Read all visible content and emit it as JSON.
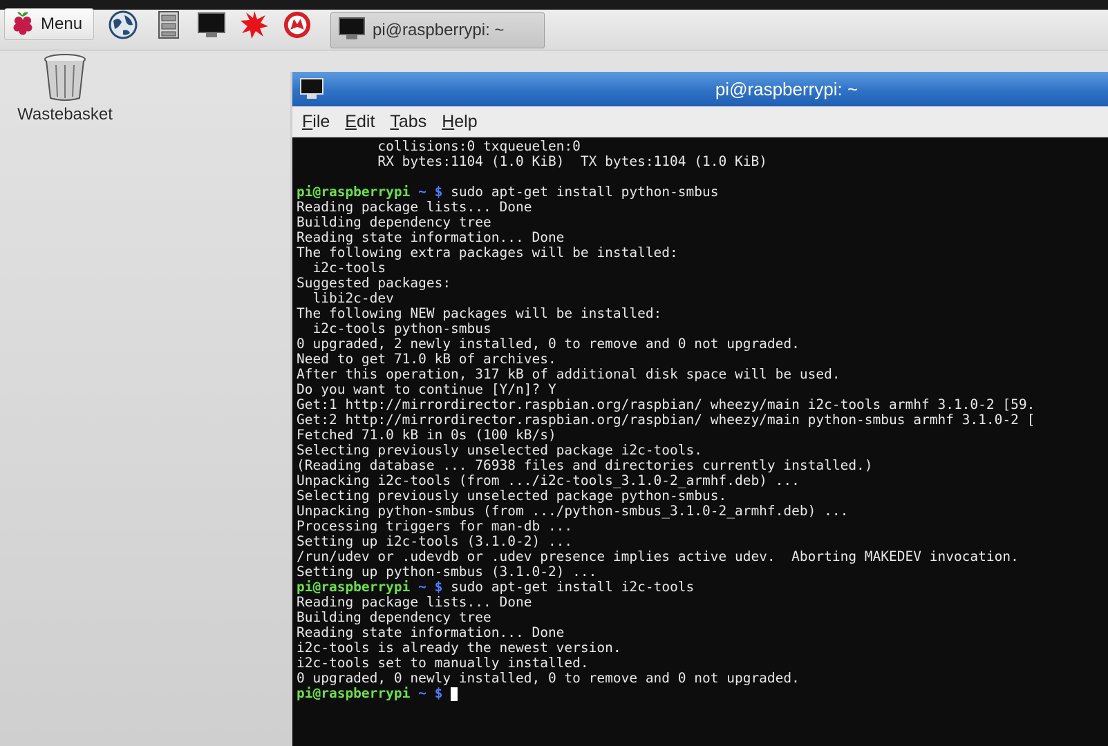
{
  "taskbar": {
    "menu_label": "Menu",
    "task_window_label": "pi@raspberrypi: ~",
    "launchers": [
      "globe-icon",
      "file-manager-icon",
      "terminal-icon",
      "mathematica-icon",
      "wolfram-icon"
    ]
  },
  "desktop": {
    "wastebasket_label": "Wastebasket"
  },
  "terminal": {
    "title": "pi@raspberrypi: ~",
    "menu": [
      "File",
      "Edit",
      "Tabs",
      "Help"
    ],
    "prompt_user": "pi@raspberrypi",
    "prompt_path": " ~ $",
    "lines": [
      {
        "t": "          collisions:0 txqueuelen:0"
      },
      {
        "t": "          RX bytes:1104 (1.0 KiB)  TX bytes:1104 (1.0 KiB)"
      },
      {
        "t": ""
      },
      {
        "prompt": true,
        "t": " sudo apt-get install python-smbus"
      },
      {
        "t": "Reading package lists... Done"
      },
      {
        "t": "Building dependency tree"
      },
      {
        "t": "Reading state information... Done"
      },
      {
        "t": "The following extra packages will be installed:"
      },
      {
        "t": "  i2c-tools"
      },
      {
        "t": "Suggested packages:"
      },
      {
        "t": "  libi2c-dev"
      },
      {
        "t": "The following NEW packages will be installed:"
      },
      {
        "t": "  i2c-tools python-smbus"
      },
      {
        "t": "0 upgraded, 2 newly installed, 0 to remove and 0 not upgraded."
      },
      {
        "t": "Need to get 71.0 kB of archives."
      },
      {
        "t": "After this operation, 317 kB of additional disk space will be used."
      },
      {
        "t": "Do you want to continue [Y/n]? Y"
      },
      {
        "t": "Get:1 http://mirrordirector.raspbian.org/raspbian/ wheezy/main i2c-tools armhf 3.1.0-2 [59."
      },
      {
        "t": "Get:2 http://mirrordirector.raspbian.org/raspbian/ wheezy/main python-smbus armhf 3.1.0-2 ["
      },
      {
        "t": "Fetched 71.0 kB in 0s (100 kB/s)"
      },
      {
        "t": "Selecting previously unselected package i2c-tools."
      },
      {
        "t": "(Reading database ... 76938 files and directories currently installed.)"
      },
      {
        "t": "Unpacking i2c-tools (from .../i2c-tools_3.1.0-2_armhf.deb) ..."
      },
      {
        "t": "Selecting previously unselected package python-smbus."
      },
      {
        "t": "Unpacking python-smbus (from .../python-smbus_3.1.0-2_armhf.deb) ..."
      },
      {
        "t": "Processing triggers for man-db ..."
      },
      {
        "t": "Setting up i2c-tools (3.1.0-2) ..."
      },
      {
        "t": "/run/udev or .udevdb or .udev presence implies active udev.  Aborting MAKEDEV invocation."
      },
      {
        "t": "Setting up python-smbus (3.1.0-2) ..."
      },
      {
        "prompt": true,
        "t": " sudo apt-get install i2c-tools"
      },
      {
        "t": "Reading package lists... Done"
      },
      {
        "t": "Building dependency tree"
      },
      {
        "t": "Reading state information... Done"
      },
      {
        "t": "i2c-tools is already the newest version."
      },
      {
        "t": "i2c-tools set to manually installed."
      },
      {
        "t": "0 upgraded, 0 newly installed, 0 to remove and 0 not upgraded."
      },
      {
        "prompt": true,
        "t": " ",
        "cursor": true
      }
    ]
  },
  "colors": {
    "prompt_user": "#6be04a",
    "prompt_path": "#4f7cff",
    "titlebar": "#2f72c6",
    "terminal_bg": "#0d0d0d",
    "terminal_fg": "#e8e8e8"
  }
}
